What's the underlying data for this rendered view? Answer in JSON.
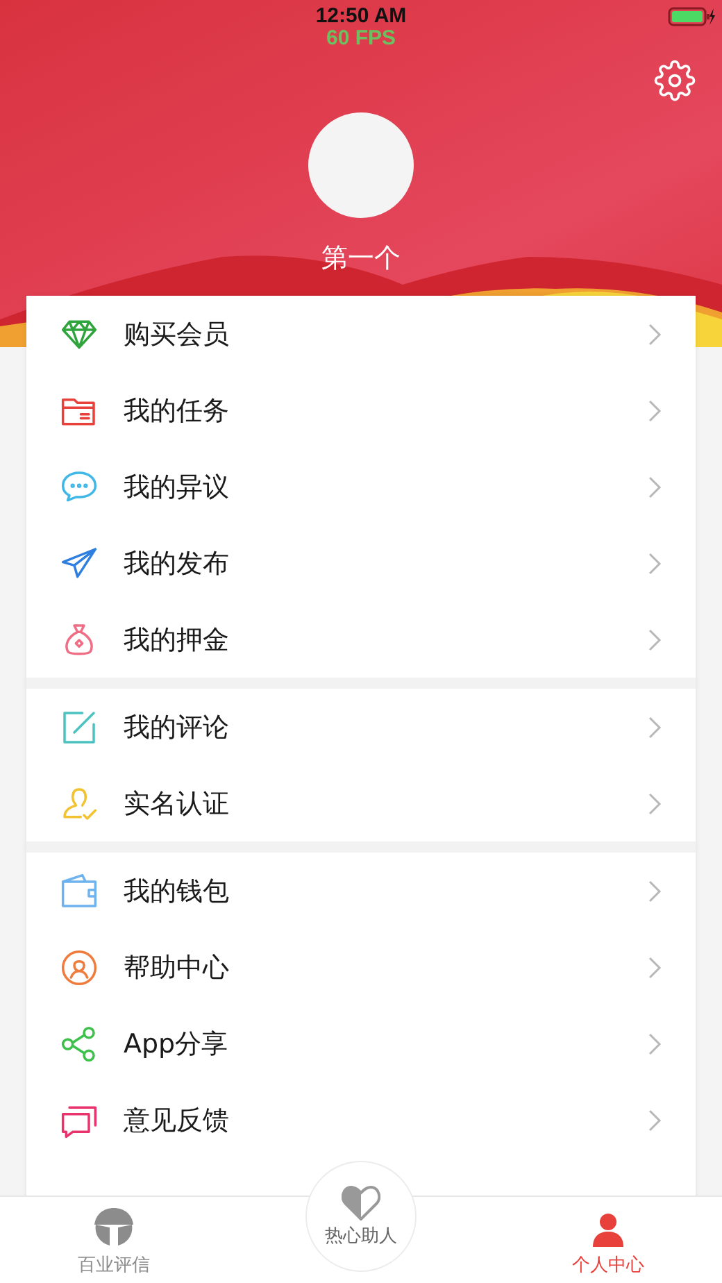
{
  "status_bar": {
    "time": "12:50 AM",
    "fps": "60 FPS"
  },
  "profile": {
    "name": "第一个"
  },
  "menu_groups": [
    [
      {
        "label": "购买会员",
        "kind": "diamond"
      },
      {
        "label": "我的任务",
        "kind": "folder"
      },
      {
        "label": "我的异议",
        "kind": "chat"
      },
      {
        "label": "我的发布",
        "kind": "send"
      },
      {
        "label": "我的押金",
        "kind": "moneybag"
      }
    ],
    [
      {
        "label": "我的评论",
        "kind": "edit"
      },
      {
        "label": "实名认证",
        "kind": "user"
      }
    ],
    [
      {
        "label": "我的钱包",
        "kind": "wallet"
      },
      {
        "label": "帮助中心",
        "kind": "support"
      },
      {
        "label": "App分享",
        "kind": "share"
      },
      {
        "label": "意见反馈",
        "kind": "feedback"
      }
    ]
  ],
  "tab_bar": [
    {
      "label": "百业评信",
      "kind": "side",
      "selected": false
    },
    {
      "label": "热心助人",
      "kind": "center",
      "selected": false
    },
    {
      "label": "个人中心",
      "kind": "side",
      "selected": true
    }
  ]
}
